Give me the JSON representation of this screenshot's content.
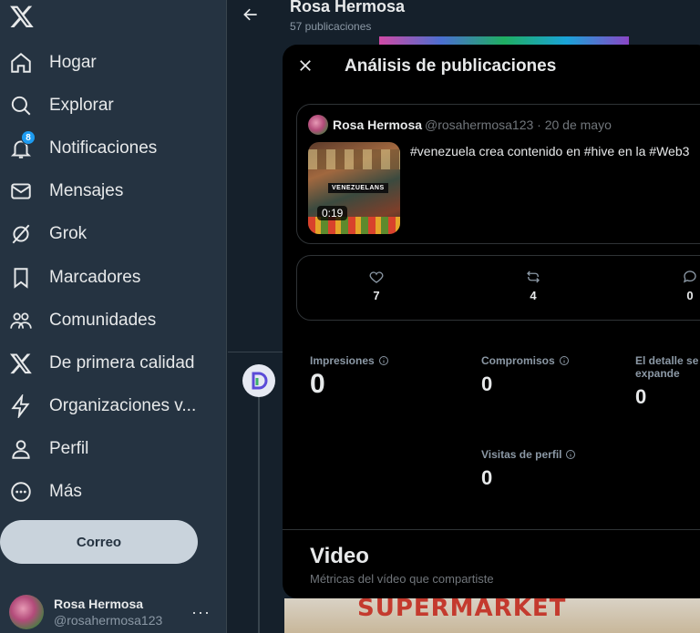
{
  "sidebar": {
    "logo_icon": "x-logo-icon",
    "items": [
      {
        "label": "Hogar",
        "icon": "home-icon"
      },
      {
        "label": "Explorar",
        "icon": "search-icon"
      },
      {
        "label": "Notificaciones",
        "icon": "bell-icon",
        "badge": "8"
      },
      {
        "label": "Mensajes",
        "icon": "mail-icon"
      },
      {
        "label": "Grok",
        "icon": "grok-icon"
      },
      {
        "label": "Marcadores",
        "icon": "bookmark-icon"
      },
      {
        "label": "Comunidades",
        "icon": "communities-icon"
      },
      {
        "label": "De primera calidad",
        "icon": "x-premium-icon"
      },
      {
        "label": "Organizaciones v...",
        "icon": "lightning-icon"
      },
      {
        "label": "Perfil",
        "icon": "person-icon"
      },
      {
        "label": "Más",
        "icon": "more-circle-icon"
      }
    ],
    "post_button": "Correo",
    "account": {
      "name": "Rosa Hermosa",
      "handle": "@rosahermosa123",
      "more": "···"
    }
  },
  "header": {
    "title": "Rosa Hermosa",
    "subtitle": "57 publicaciones"
  },
  "modal": {
    "title": "Análisis de publicaciones",
    "post": {
      "author": "Rosa Hermosa",
      "handle_date": "@rosahermosa123 · 20 de mayo",
      "text": "#venezuela crea contenido en #hive en la #Web3",
      "thumbnail_label": "VENEZUELANS",
      "duration": "0:19"
    },
    "engagement": {
      "likes": "7",
      "reposts": "4",
      "replies": "0"
    },
    "metrics": {
      "impressions_label": "Impresiones",
      "impressions": "0",
      "engagements_label": "Compromisos",
      "engagements": "0",
      "detail_label": "El detalle se expande",
      "detail": "0",
      "profile_visits_label": "Visitas de perfil",
      "profile_visits": "0"
    },
    "video": {
      "title": "Video",
      "subtitle": "Métricas del vídeo que compartiste"
    }
  },
  "background": {
    "banner_sign": "SUPERMARKET"
  },
  "colors": {
    "sidebar_bg": "#253341",
    "modal_bg": "#000000",
    "accent": "#1d9bf0",
    "muted_text": "#8b98a5"
  }
}
